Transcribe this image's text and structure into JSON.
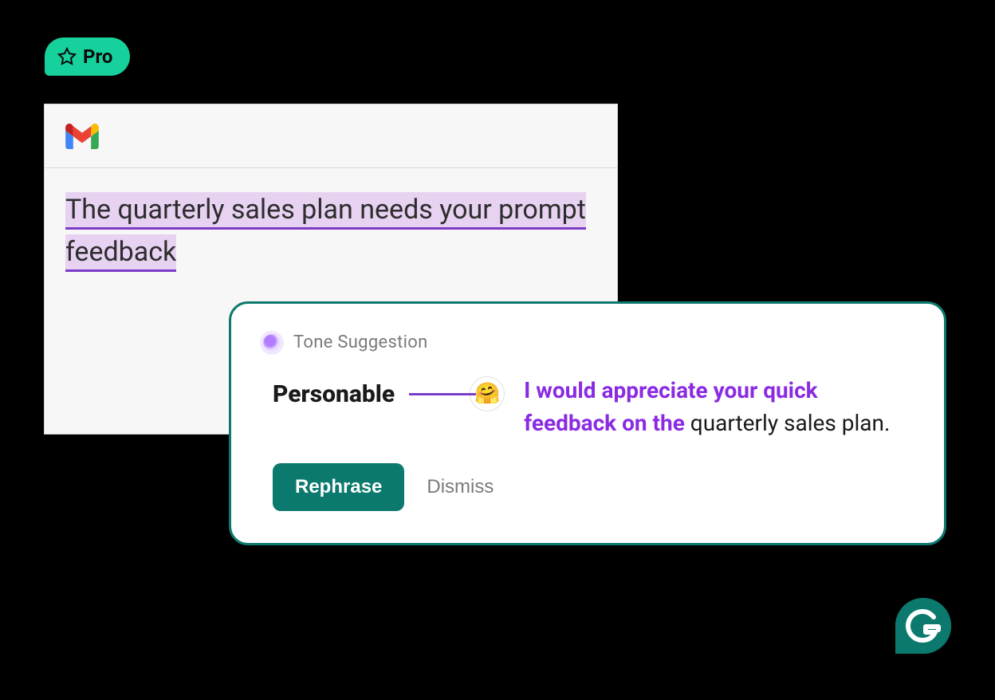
{
  "badge": {
    "label": "Pro"
  },
  "email": {
    "text": "The quarterly sales plan needs your prompt feedback"
  },
  "suggestion": {
    "title": "Tone Suggestion",
    "tone_label": "Personable",
    "emoji": "🤗",
    "rewrite_highlight": "I would appreciate your quick feedback on the",
    "rewrite_rest": " quarterly sales plan.",
    "rephrase": "Rephrase",
    "dismiss": "Dismiss"
  }
}
